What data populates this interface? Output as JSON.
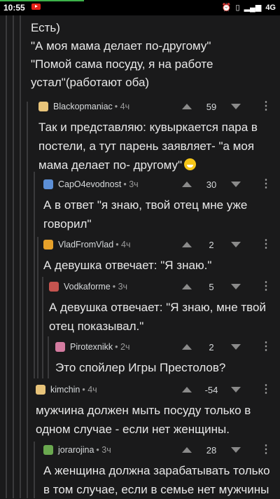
{
  "status_bar": {
    "time": "10:55",
    "network": "4G",
    "icons": [
      "youtube-icon",
      "alarm-icon",
      "vibrate-icon",
      "signal-icon"
    ]
  },
  "top_comment": {
    "lines": [
      "Есть)",
      "\"А моя мама делает по-другому\"",
      "\"Помой сама посуду, я на работе",
      "устал\"(работают оба)"
    ]
  },
  "comments": [
    {
      "user": "Blackopmaniac",
      "age": "• 4ч",
      "score": "59",
      "avatar_color": "#e8c47a",
      "lines": [
        "Так и представляю: кувыркается пара в",
        "постели, а тут парень заявляет- \"а моя",
        "мама делает по- другому\""
      ],
      "emoji_on_last": true
    },
    {
      "user": "CapO4evodnost",
      "age": "• 3ч",
      "score": "30",
      "avatar_color": "#5c8fd6",
      "lines": [
        "А в ответ \"я знаю, твой отец мне уже",
        "говорил\""
      ]
    },
    {
      "user": "VladFromVlad",
      "age": "• 4ч",
      "score": "2",
      "avatar_color": "#e6a12a",
      "lines": [
        "А девушка отвечает: \"Я знаю.\""
      ]
    },
    {
      "user": "Vodkaforme",
      "age": "• 3ч",
      "score": "5",
      "avatar_color": "#c4544f",
      "lines": [
        "А девушка отвечает: \"Я знаю, мне твой",
        "отец показывал.\""
      ]
    },
    {
      "user": "Pirotexnikk",
      "age": "• 2ч",
      "score": "2",
      "avatar_color": "#d47ba0",
      "lines": [
        "Это спойлер Игры Престолов?"
      ]
    },
    {
      "user": "kimchin",
      "age": "• 4ч",
      "score": "-54",
      "avatar_color": "#e8c47a",
      "lines": [
        "мужчина должен мыть посуду только в",
        "одном случае - если нет женщины."
      ]
    },
    {
      "user": "jorarojina",
      "age": "• 3ч",
      "score": "28",
      "avatar_color": "#6aa84f",
      "lines": [
        "А женщина должна зарабатывать только",
        "в том случае, если в семье нет мужчины"
      ]
    }
  ]
}
